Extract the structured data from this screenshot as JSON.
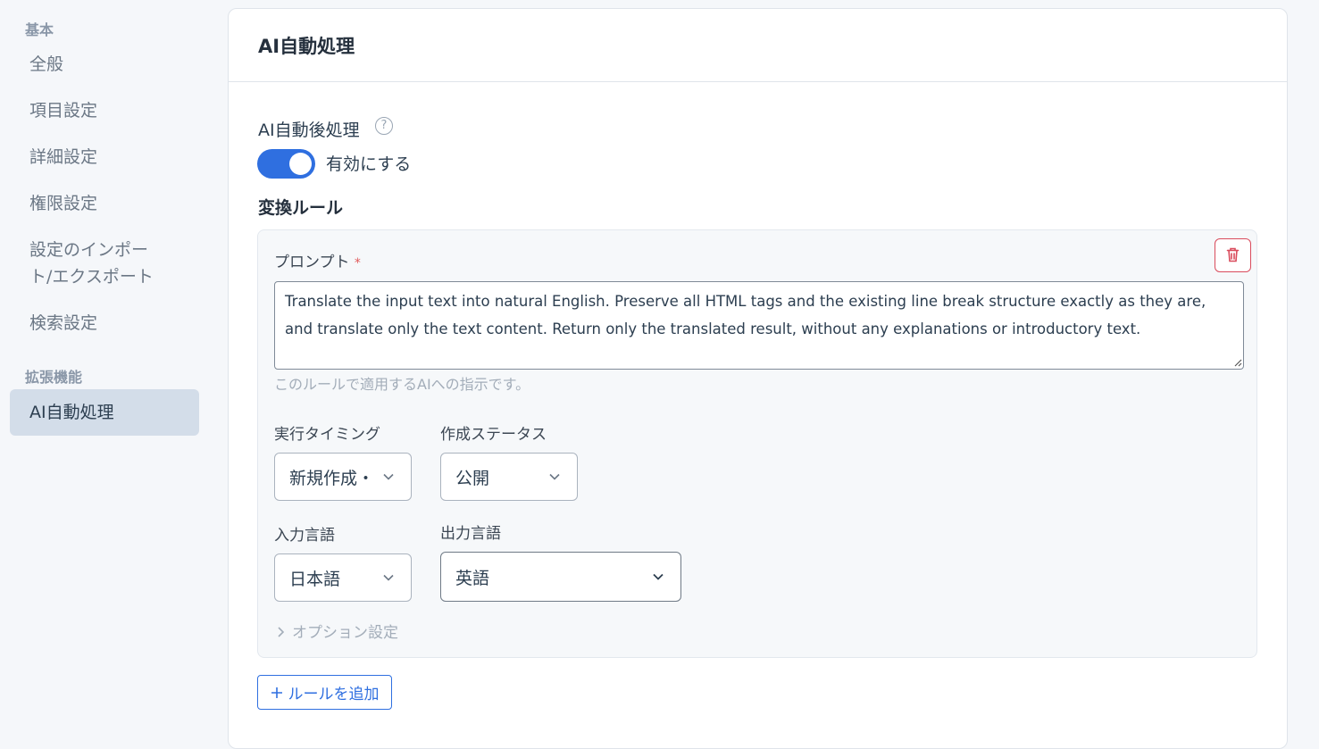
{
  "sidebar": {
    "group_basic": "基本",
    "items": [
      {
        "label": "全般"
      },
      {
        "label": "項目設定"
      },
      {
        "label": "詳細設定"
      },
      {
        "label": "権限設定"
      },
      {
        "label_line1": "設定のインポー",
        "label_line2": "ト/エクスポート"
      },
      {
        "label": "検索設定"
      }
    ],
    "group_ext": "拡張機能",
    "active_item": "AI自動処理"
  },
  "page": {
    "title": "AI自動処理",
    "post_process_label": "AI自動後処理",
    "help_icon": "question-circle-icon",
    "toggle_label": "有効にする",
    "toggle_on": true,
    "rules_title": "変換ルール"
  },
  "rule": {
    "prompt_label": "プロンプト",
    "required_mark": "*",
    "prompt_value": "Translate the input text into natural English. Preserve all HTML tags and the existing line break structure exactly as they are, and translate only the text content. Return only the translated result, without any explanations or introductory text.",
    "prompt_hint": "このルールで適用するAIへの指示です。",
    "timing_label": "実行タイミング",
    "timing_value": "新規作成・",
    "status_label": "作成ステータス",
    "status_value": "公開",
    "input_lang_label": "入力言語",
    "input_lang_value": "日本語",
    "output_lang_label": "出力言語",
    "output_lang_value": "英語",
    "options_label": "オプション設定"
  },
  "add_rule_label": "ルールを追加",
  "colors": {
    "accent": "#2f6fe0",
    "danger": "#d94b5c",
    "sidebar_active": "#d3dde9"
  }
}
